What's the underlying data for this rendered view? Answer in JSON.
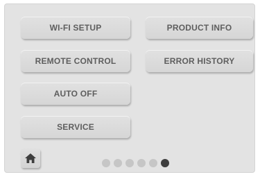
{
  "menu": {
    "wifi_setup": "WI-FI SETUP",
    "product_info": "PRODUCT INFO",
    "remote_control": "REMOTE CONTROL",
    "error_history": "ERROR HISTORY",
    "auto_off": "AUTO OFF",
    "service": "SERVICE"
  },
  "footer": {
    "home_icon": "home-icon",
    "pager": {
      "total_pages": 6,
      "active_page": 6
    }
  },
  "colors": {
    "panel_bg": "#e3e3e3",
    "button_text": "#5e5e5e",
    "dot_inactive": "#c6c6c6",
    "dot_active": "#3e3e3e"
  }
}
